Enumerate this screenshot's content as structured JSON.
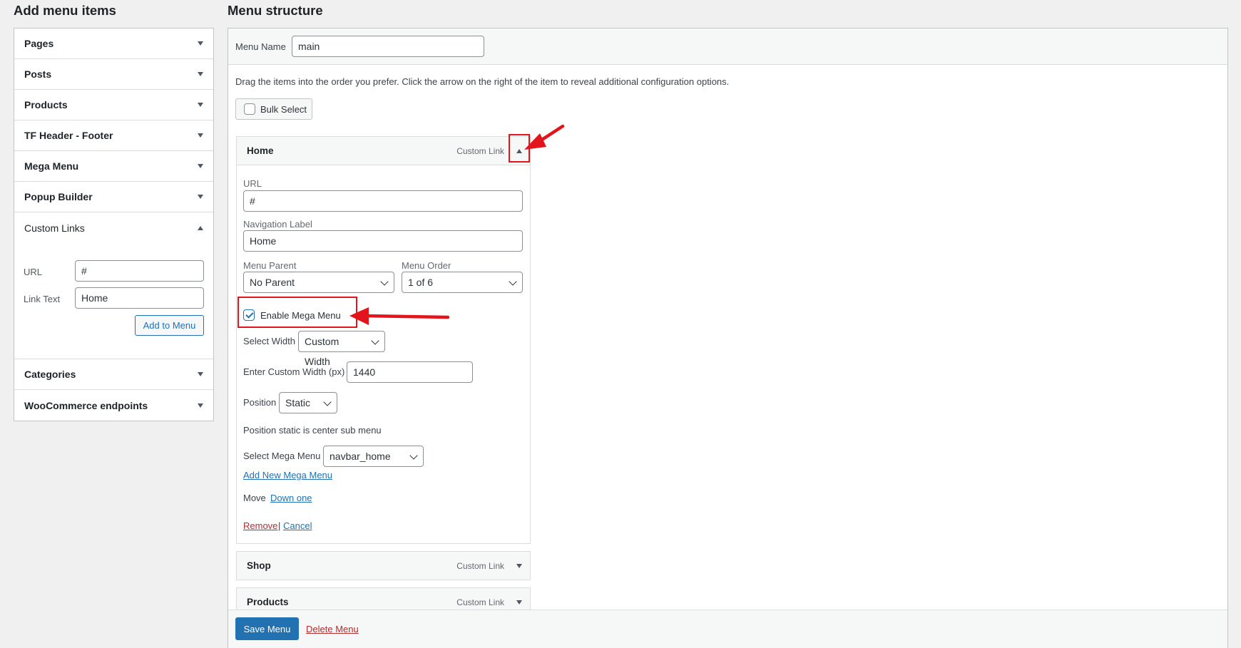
{
  "left": {
    "title": "Add menu items",
    "sections_top": [
      {
        "label": "Pages"
      },
      {
        "label": "Posts"
      },
      {
        "label": "Products"
      },
      {
        "label": "TF Header - Footer"
      },
      {
        "label": "Mega Menu"
      },
      {
        "label": "Popup Builder"
      }
    ],
    "custom_links": {
      "label": "Custom Links",
      "url_label": "URL",
      "url_value": "#",
      "link_text_label": "Link Text",
      "link_text_value": "Home",
      "add_button": "Add to Menu"
    },
    "sections_bottom": [
      {
        "label": "Categories"
      },
      {
        "label": "WooCommerce endpoints"
      }
    ]
  },
  "right": {
    "title": "Menu structure",
    "menu_name_label": "Menu Name",
    "menu_name_value": "main",
    "instructions": "Drag the items into the order you prefer. Click the arrow on the right of the item to reveal additional configuration options.",
    "bulk_select": "Bulk Select"
  },
  "item_home": {
    "title": "Home",
    "type": "Custom Link",
    "url_label": "URL",
    "url_value": "#",
    "nav_label": "Navigation Label",
    "nav_value": "Home",
    "parent_label": "Menu Parent",
    "parent_value": "No Parent",
    "order_label": "Menu Order",
    "order_value": "1 of 6",
    "enable_mega": "Enable Mega Menu",
    "enable_mega_checked": true,
    "select_width_label": "Select Width",
    "select_width_value": "Custom Width",
    "custom_width_label": "Enter Custom Width (px)",
    "custom_width_value": "1440",
    "position_label": "Position",
    "position_value": "Static",
    "position_note": "Position static is center sub menu",
    "select_mega_label": "Select Mega Menu",
    "select_mega_value": "navbar_home",
    "add_new_mega": "Add New Mega Menu",
    "move_label": "Move",
    "move_link": "Down one",
    "remove": "Remove",
    "separator": "|",
    "cancel": "Cancel"
  },
  "item_shop": {
    "title": "Shop",
    "type": "Custom Link"
  },
  "item_products": {
    "title": "Products",
    "type": "Custom Link"
  },
  "footer": {
    "save": "Save Menu",
    "delete": "Delete Menu"
  },
  "colors": {
    "accent": "#2271b1",
    "annotation": "#e2141c",
    "danger": "#b32d2e"
  }
}
